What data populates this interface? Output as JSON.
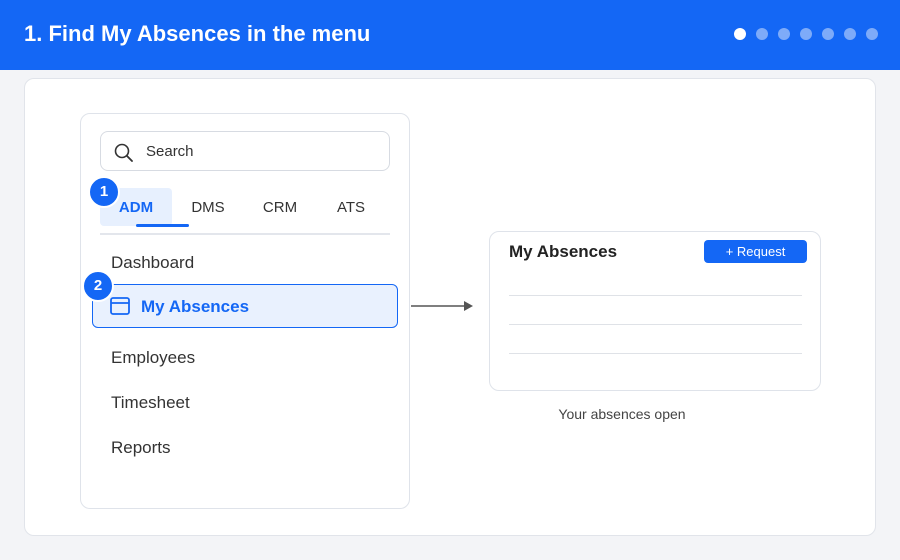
{
  "header": {
    "title": "1. Find My Absences in the menu",
    "step_dots": 7,
    "active_step": 1,
    "accent_color": "#1467f5"
  },
  "menu": {
    "search": {
      "placeholder": "Search",
      "icon": "search-icon"
    },
    "tabs": [
      {
        "label": "ADM",
        "active": true
      },
      {
        "label": "DMS",
        "active": false
      },
      {
        "label": "CRM",
        "active": false
      },
      {
        "label": "ATS",
        "active": false
      }
    ],
    "items": [
      {
        "label": "Dashboard"
      },
      {
        "label": "My Absences",
        "highlighted": true,
        "icon": "calendar-icon"
      },
      {
        "label": "Employees"
      },
      {
        "label": "Timesheet"
      },
      {
        "label": "Reports"
      }
    ]
  },
  "badges": {
    "step1": "1",
    "step2": "2"
  },
  "preview": {
    "title": "My Absences",
    "button_label": "+ Request",
    "caption": "Your absences open"
  }
}
